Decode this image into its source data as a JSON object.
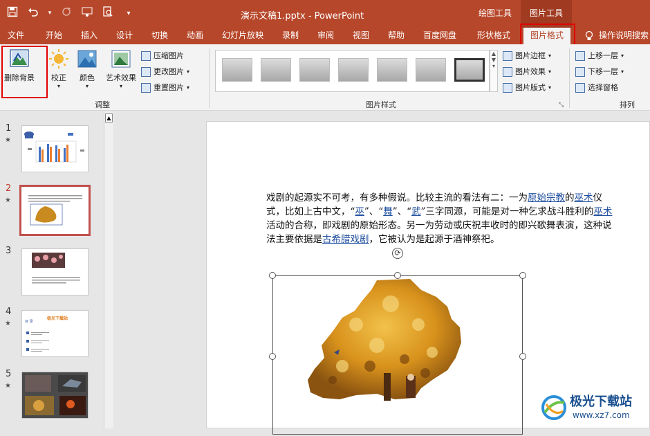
{
  "titlebar": {
    "qat_icons": [
      "save-icon",
      "undo-icon",
      "undo-dropdown-icon",
      "redo-icon",
      "touch-mode-icon",
      "print-preview-icon",
      "customize-qat-icon"
    ],
    "doc_title": "演示文稿1.pptx - PowerPoint",
    "context_groups": [
      "绘图工具",
      "图片工具"
    ]
  },
  "tabs": {
    "file": "文件",
    "home": "开始",
    "insert": "插入",
    "design": "设计",
    "transitions": "切换",
    "animations": "动画",
    "slideshow": "幻灯片放映",
    "record": "录制",
    "review": "审阅",
    "view": "视图",
    "help": "帮助",
    "baidu": "百度网盘",
    "shape_format": "形状格式",
    "picture_format": "图片格式",
    "tell_me": "操作说明搜索"
  },
  "ribbon": {
    "remove_bg": "删除背景",
    "corrections": "校正",
    "color": "颜色",
    "artistic": "艺术效果",
    "compress": "压缩图片",
    "change_picture": "更改图片",
    "reset_picture": "重置图片",
    "adjust_group": "调整",
    "picture_styles_group": "图片样式",
    "border": "图片边框",
    "effects": "图片效果",
    "layout": "图片版式",
    "bring_forward": "上移一层",
    "send_backward": "下移一层",
    "selection_pane": "选择窗格",
    "arrange_group": "排列"
  },
  "slides": [
    {
      "num": "1",
      "star": "★"
    },
    {
      "num": "2",
      "star": "★"
    },
    {
      "num": "3",
      "star": ""
    },
    {
      "num": "4",
      "star": "★"
    },
    {
      "num": "5",
      "star": "★"
    }
  ],
  "thumb4_title": "极光下载站",
  "thumb4_sub": "目 录",
  "slide_text": {
    "t1": "戏剧的起源实不可考，有多种假说。比较主流的看法有二：一为",
    "l1": "原始宗教",
    "t2": "的",
    "l2": "巫术",
    "t3": "仪式，比如上古中文，“",
    "l3": "巫",
    "t4": "”、“",
    "l4": "舞",
    "t5": "”、“",
    "l5": "武",
    "t6": "”三字同源，可能是对一种乞求战斗胜利的",
    "l6": "巫术",
    "t7": "活动的合称，即戏剧的原始形态。另一为劳动或庆祝丰收时的即兴歌舞表演，这种说法主要依据是",
    "l7": "古希腊戏剧",
    "t8": "，它被认为是起源于酒神祭祀。"
  },
  "watermark": {
    "title": "极光下载站",
    "url": "www.xz7.com"
  },
  "colors": {
    "accent": "#b7472a",
    "highlight_box": "#e00000",
    "link": "#1f4fa0"
  }
}
